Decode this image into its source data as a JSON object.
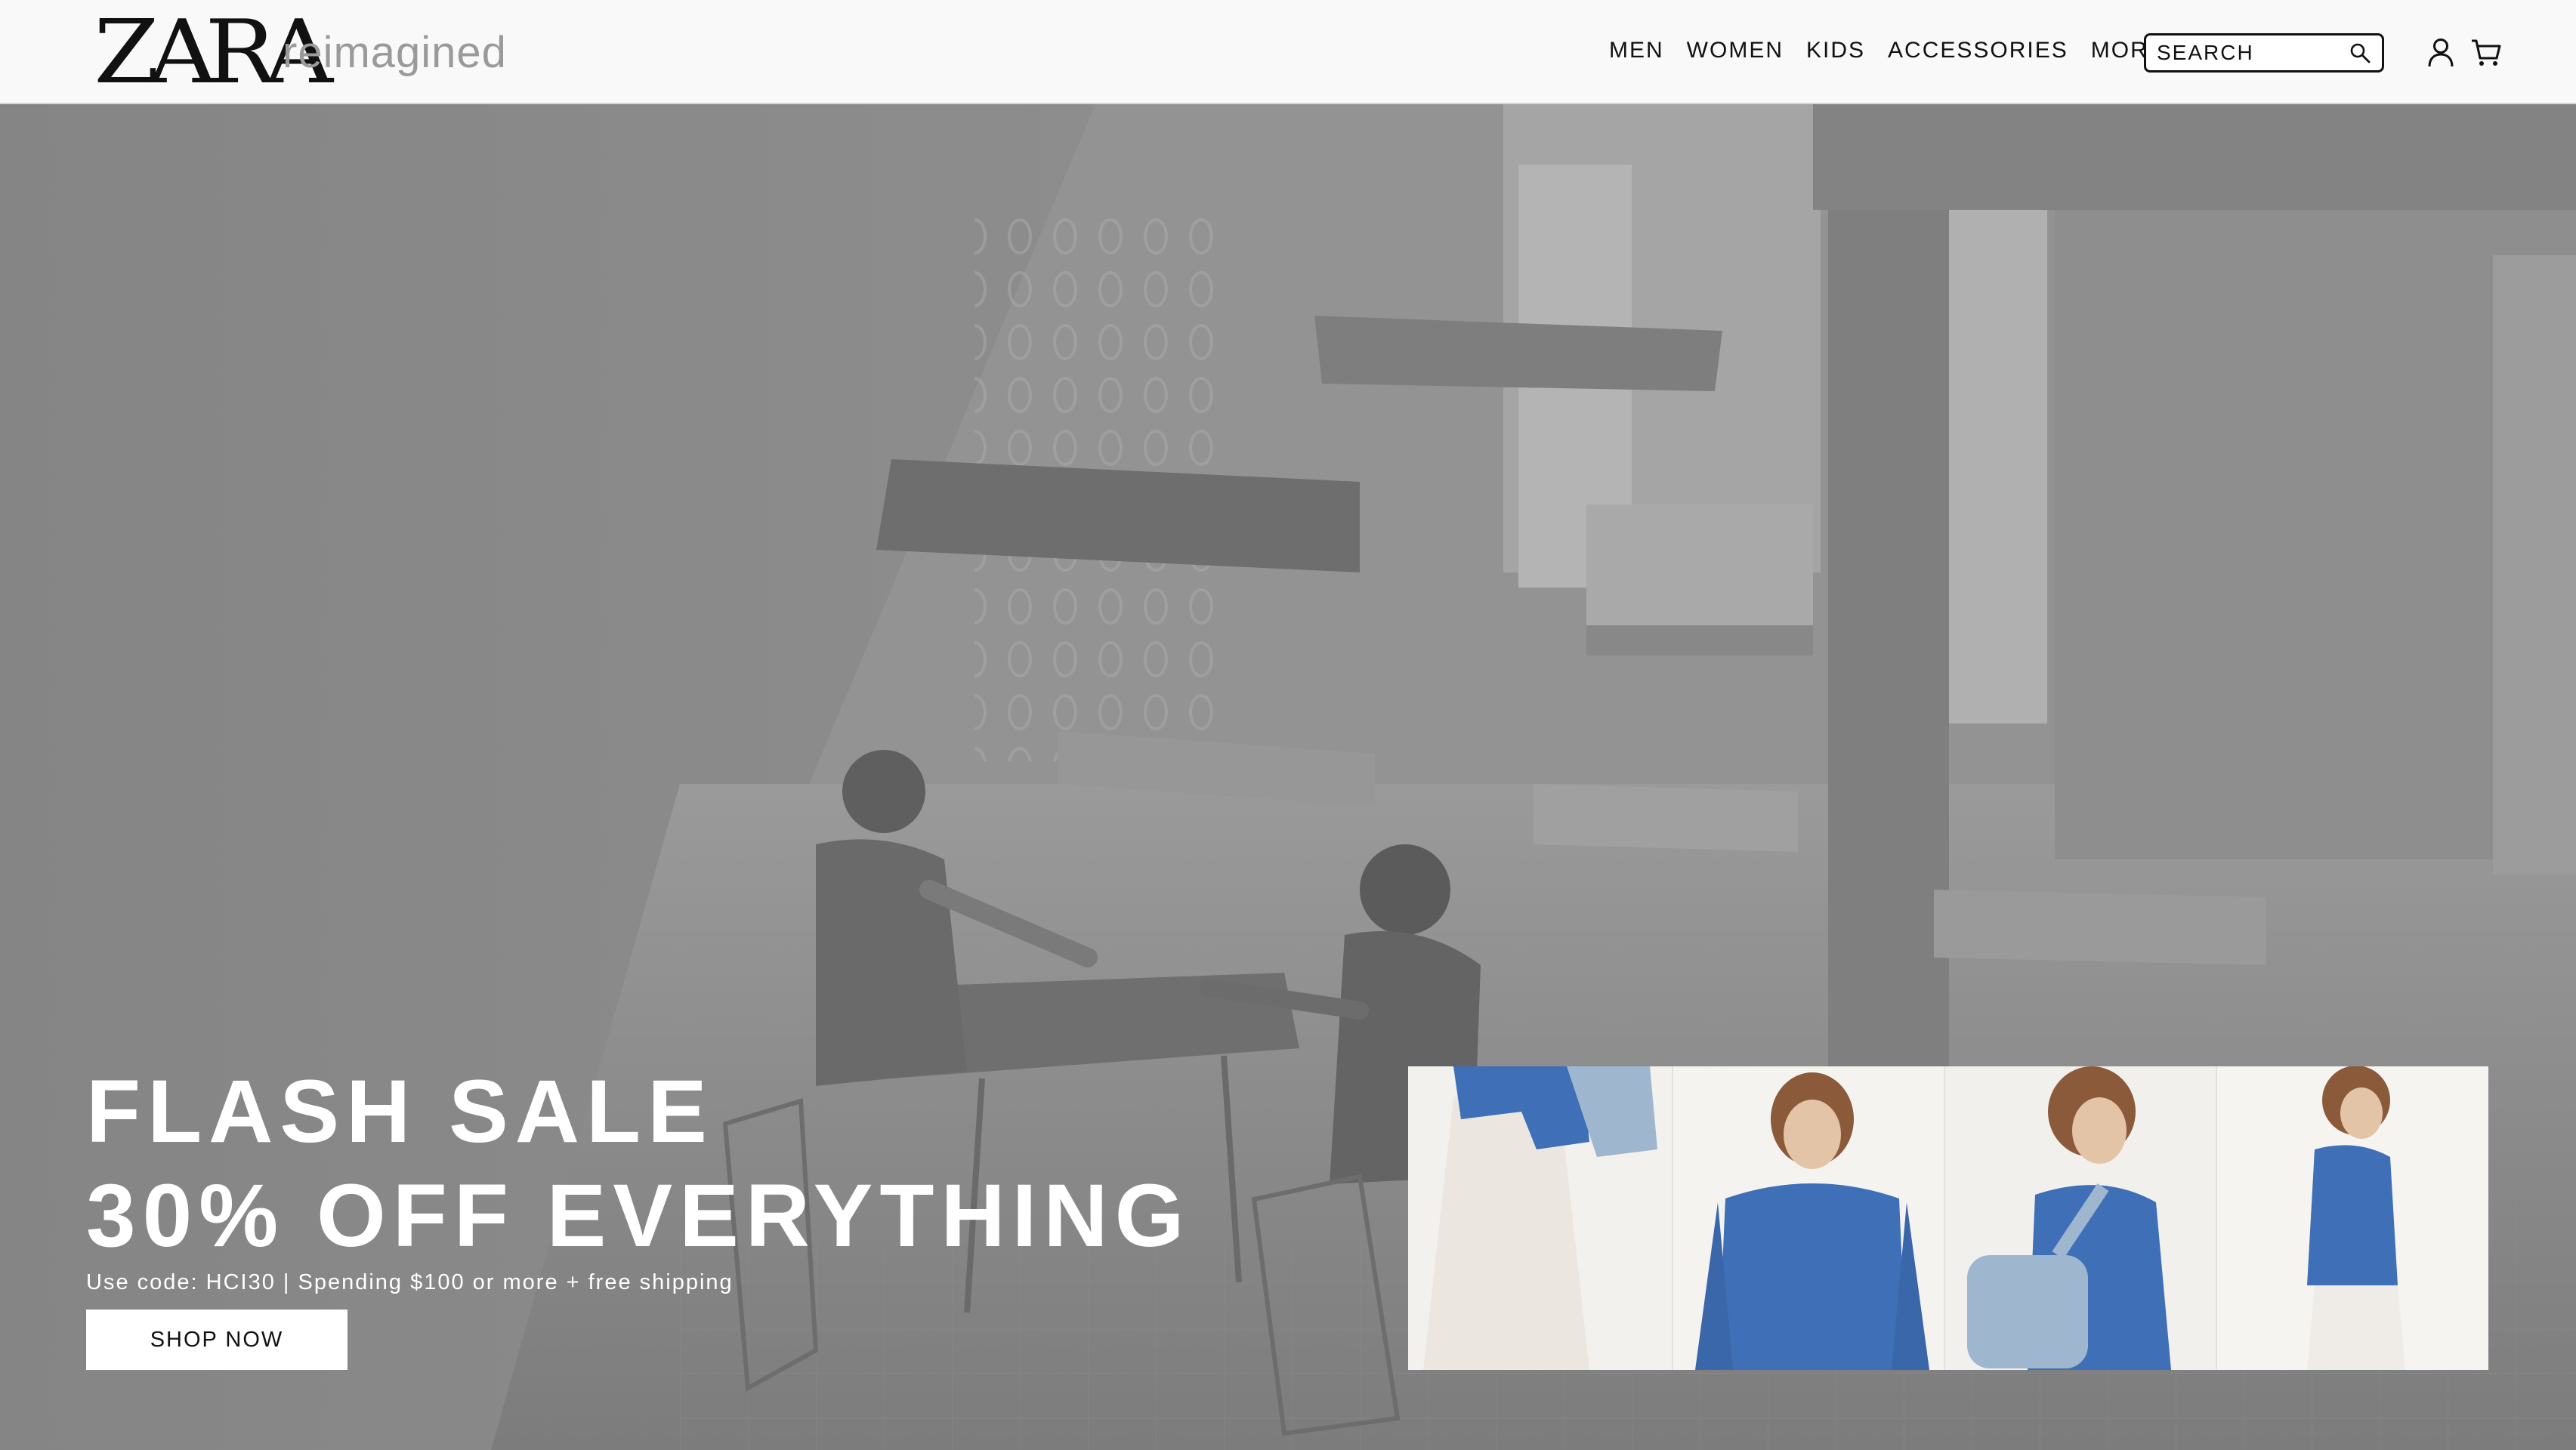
{
  "header": {
    "logo_text": "ZARA",
    "logo_subtitle": "reimagined",
    "nav": [
      {
        "label": "MEN"
      },
      {
        "label": "WOMEN"
      },
      {
        "label": "KIDS"
      },
      {
        "label": "ACCESSORIES"
      },
      {
        "label": "MORE"
      }
    ],
    "search": {
      "placeholder": "SEARCH"
    }
  },
  "hero": {
    "title_line1": "FLASH SALE",
    "title_line2": "30% OFF EVERYTHING",
    "subtitle": "Use code: HCI30 | Spending $100 or more + free shipping",
    "cta_label": "SHOP NOW"
  },
  "icons": {
    "search": "search-icon",
    "user": "user-icon",
    "cart": "cart-icon"
  },
  "colors": {
    "header_bg": "#f9f9f9",
    "hero_overlay": "#8a8a8a",
    "sweater_blue": "#3f6fb6",
    "text_dark": "#111111",
    "logo_subtitle": "#9a9a9a"
  }
}
